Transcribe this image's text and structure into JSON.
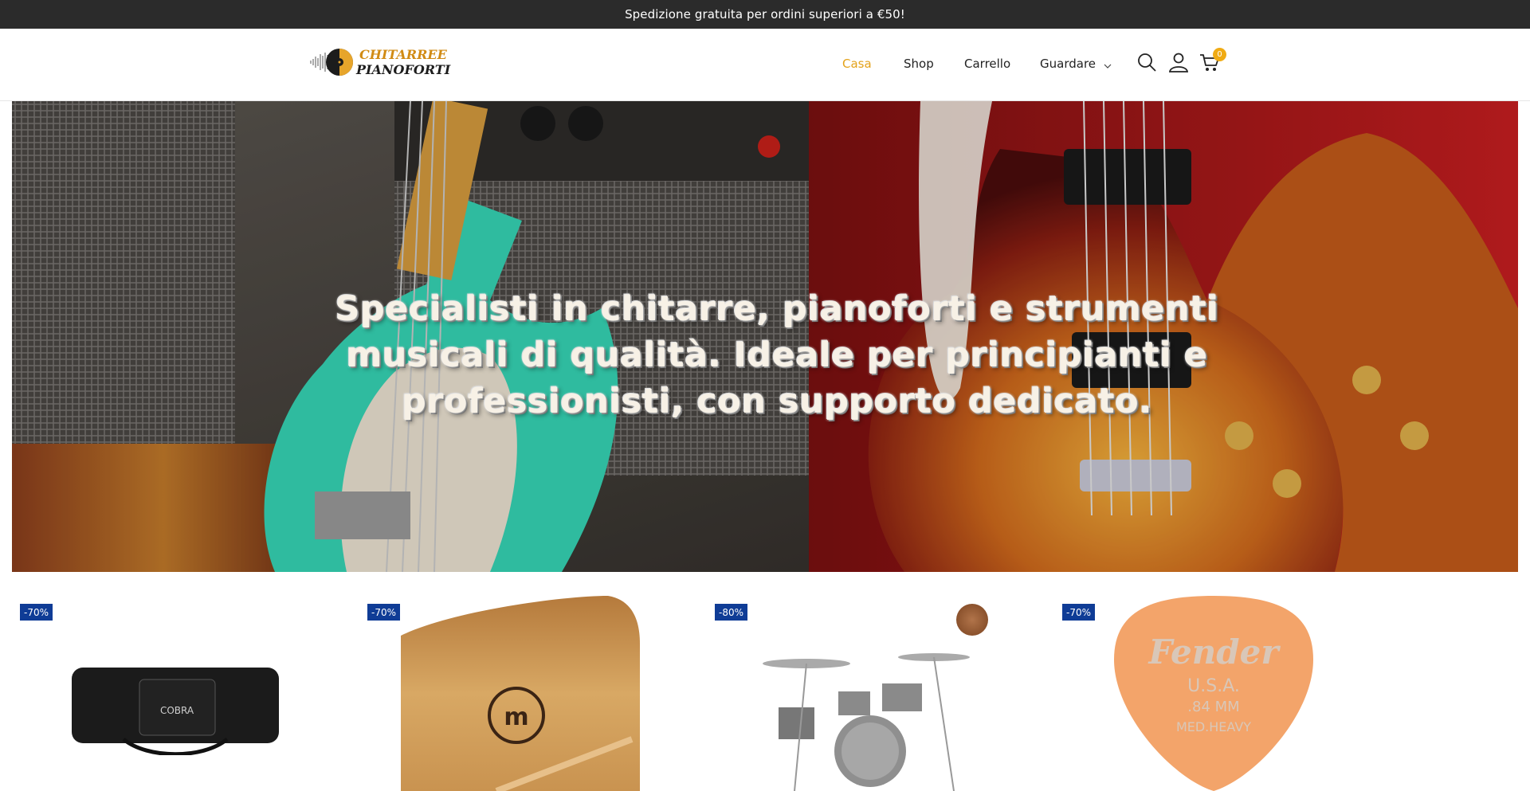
{
  "announcement": "Spedizione gratuita per ordini superiori a €50!",
  "logo": {
    "line1": "CHITARREE",
    "line2": "PIANOFORTI"
  },
  "nav": {
    "items": [
      {
        "label": "Casa",
        "active": true
      },
      {
        "label": "Shop",
        "active": false
      },
      {
        "label": "Carrello",
        "active": false
      },
      {
        "label": "Guardare",
        "active": false,
        "has_dropdown": true
      }
    ]
  },
  "header_icons": {
    "search": "search-icon",
    "account": "user-icon",
    "cart": "cart-icon",
    "cart_count": "0"
  },
  "hero": {
    "title": "Specialisti in chitarre, pianoforti e strumenti musicali di qualità. Ideale per principianti e professionisti, con supporto dedicato."
  },
  "products": [
    {
      "badge": "-70%",
      "image": "keyboard-gig-bag"
    },
    {
      "badge": "-70%",
      "image": "wood-block"
    },
    {
      "badge": "-80%",
      "image": "drum-kit"
    },
    {
      "badge": "-70%",
      "image": "fender-guitar-pick"
    }
  ],
  "colors": {
    "accent": "#e3a21a",
    "badge": "#0f3c96",
    "announce_bg": "#2b2b2b",
    "cart_badge": "#f0ab14"
  }
}
